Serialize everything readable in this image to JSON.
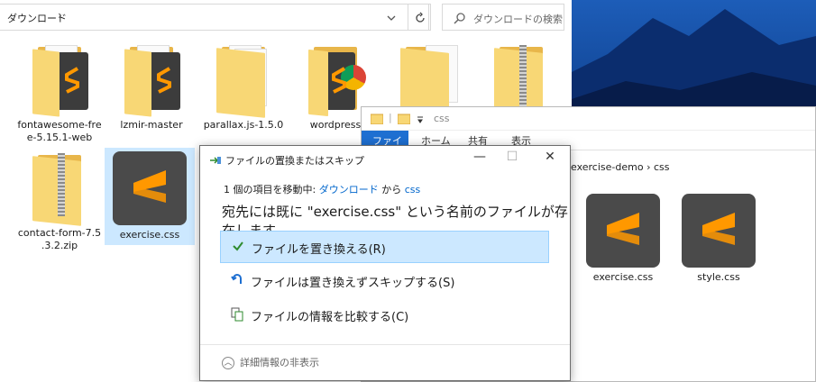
{
  "explorer_left": {
    "breadcrumb": "ダウンロード",
    "search_placeholder": "ダウンロードの検索",
    "items": [
      {
        "name": "fontawesome-free-5.15.1-web",
        "kind": "folder-sublime"
      },
      {
        "name": "lzmir-master",
        "kind": "folder-sublime"
      },
      {
        "name": "parallax.js-1.5.0",
        "kind": "folder"
      },
      {
        "name": "wordpress",
        "kind": "folder-chrome"
      },
      {
        "name": "contact-form-7.5.3.2.zip",
        "kind": "zip"
      },
      {
        "name": "exercise.css",
        "kind": "sublime",
        "selected": true
      }
    ],
    "name_lines": {
      "fontawesome": [
        "fontawesome-fre",
        "e-5.15.1-web"
      ],
      "lzmir": [
        "lzmir-master"
      ],
      "parallax": [
        "parallax.js-1.5.0"
      ],
      "wordpress": [
        "wordpress"
      ],
      "contact": [
        "contact-form-7.5",
        ".3.2.zip"
      ],
      "exercise": [
        "exercise.css"
      ]
    }
  },
  "explorer_right": {
    "title_path": "css",
    "ribbon_tabs": [
      "ファイル",
      "ホーム",
      "共有",
      "表示"
    ],
    "breadcrumb": [
      "exercise-demo",
      "css"
    ],
    "files": [
      "exercise.css",
      "style.css"
    ]
  },
  "dialog": {
    "title": "ファイルの置換またはスキップ",
    "move_prefix": "1 個の項目を移動中:",
    "move_from": "ダウンロード",
    "move_mid": "から",
    "move_to": "css",
    "headline": "宛先には既に \"exercise.css\" という名前のファイルが存在します",
    "options": [
      {
        "label": "ファイルを置き換える(R)",
        "icon": "checkmark-icon",
        "highlighted": true
      },
      {
        "label": "ファイルは置き換えずスキップする(S)",
        "icon": "skip-icon",
        "highlighted": false
      },
      {
        "label": "ファイルの情報を比較する(C)",
        "icon": "compare-icon",
        "highlighted": false
      }
    ],
    "details_label": "詳細情報の非表示",
    "window_buttons": {
      "minimize": "—",
      "maximize": "☐",
      "close": "✕"
    }
  },
  "colors": {
    "sublime_orange": "#ff9800",
    "accent_blue": "#1e6fd1",
    "highlight": "#cce8ff",
    "checkmark": "#2e8b2e"
  }
}
